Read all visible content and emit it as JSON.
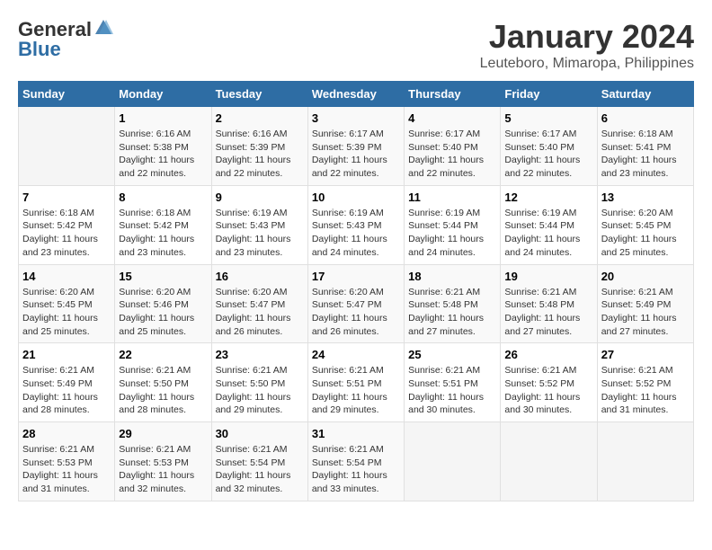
{
  "header": {
    "logo_general": "General",
    "logo_blue": "Blue",
    "month_title": "January 2024",
    "location": "Leuteboro, Mimaropa, Philippines"
  },
  "days_of_week": [
    "Sunday",
    "Monday",
    "Tuesday",
    "Wednesday",
    "Thursday",
    "Friday",
    "Saturday"
  ],
  "weeks": [
    [
      {
        "day": "",
        "info": ""
      },
      {
        "day": "1",
        "info": "Sunrise: 6:16 AM\nSunset: 5:38 PM\nDaylight: 11 hours\nand 22 minutes."
      },
      {
        "day": "2",
        "info": "Sunrise: 6:16 AM\nSunset: 5:39 PM\nDaylight: 11 hours\nand 22 minutes."
      },
      {
        "day": "3",
        "info": "Sunrise: 6:17 AM\nSunset: 5:39 PM\nDaylight: 11 hours\nand 22 minutes."
      },
      {
        "day": "4",
        "info": "Sunrise: 6:17 AM\nSunset: 5:40 PM\nDaylight: 11 hours\nand 22 minutes."
      },
      {
        "day": "5",
        "info": "Sunrise: 6:17 AM\nSunset: 5:40 PM\nDaylight: 11 hours\nand 22 minutes."
      },
      {
        "day": "6",
        "info": "Sunrise: 6:18 AM\nSunset: 5:41 PM\nDaylight: 11 hours\nand 23 minutes."
      }
    ],
    [
      {
        "day": "7",
        "info": "Sunrise: 6:18 AM\nSunset: 5:42 PM\nDaylight: 11 hours\nand 23 minutes."
      },
      {
        "day": "8",
        "info": "Sunrise: 6:18 AM\nSunset: 5:42 PM\nDaylight: 11 hours\nand 23 minutes."
      },
      {
        "day": "9",
        "info": "Sunrise: 6:19 AM\nSunset: 5:43 PM\nDaylight: 11 hours\nand 23 minutes."
      },
      {
        "day": "10",
        "info": "Sunrise: 6:19 AM\nSunset: 5:43 PM\nDaylight: 11 hours\nand 24 minutes."
      },
      {
        "day": "11",
        "info": "Sunrise: 6:19 AM\nSunset: 5:44 PM\nDaylight: 11 hours\nand 24 minutes."
      },
      {
        "day": "12",
        "info": "Sunrise: 6:19 AM\nSunset: 5:44 PM\nDaylight: 11 hours\nand 24 minutes."
      },
      {
        "day": "13",
        "info": "Sunrise: 6:20 AM\nSunset: 5:45 PM\nDaylight: 11 hours\nand 25 minutes."
      }
    ],
    [
      {
        "day": "14",
        "info": "Sunrise: 6:20 AM\nSunset: 5:45 PM\nDaylight: 11 hours\nand 25 minutes."
      },
      {
        "day": "15",
        "info": "Sunrise: 6:20 AM\nSunset: 5:46 PM\nDaylight: 11 hours\nand 25 minutes."
      },
      {
        "day": "16",
        "info": "Sunrise: 6:20 AM\nSunset: 5:47 PM\nDaylight: 11 hours\nand 26 minutes."
      },
      {
        "day": "17",
        "info": "Sunrise: 6:20 AM\nSunset: 5:47 PM\nDaylight: 11 hours\nand 26 minutes."
      },
      {
        "day": "18",
        "info": "Sunrise: 6:21 AM\nSunset: 5:48 PM\nDaylight: 11 hours\nand 27 minutes."
      },
      {
        "day": "19",
        "info": "Sunrise: 6:21 AM\nSunset: 5:48 PM\nDaylight: 11 hours\nand 27 minutes."
      },
      {
        "day": "20",
        "info": "Sunrise: 6:21 AM\nSunset: 5:49 PM\nDaylight: 11 hours\nand 27 minutes."
      }
    ],
    [
      {
        "day": "21",
        "info": "Sunrise: 6:21 AM\nSunset: 5:49 PM\nDaylight: 11 hours\nand 28 minutes."
      },
      {
        "day": "22",
        "info": "Sunrise: 6:21 AM\nSunset: 5:50 PM\nDaylight: 11 hours\nand 28 minutes."
      },
      {
        "day": "23",
        "info": "Sunrise: 6:21 AM\nSunset: 5:50 PM\nDaylight: 11 hours\nand 29 minutes."
      },
      {
        "day": "24",
        "info": "Sunrise: 6:21 AM\nSunset: 5:51 PM\nDaylight: 11 hours\nand 29 minutes."
      },
      {
        "day": "25",
        "info": "Sunrise: 6:21 AM\nSunset: 5:51 PM\nDaylight: 11 hours\nand 30 minutes."
      },
      {
        "day": "26",
        "info": "Sunrise: 6:21 AM\nSunset: 5:52 PM\nDaylight: 11 hours\nand 30 minutes."
      },
      {
        "day": "27",
        "info": "Sunrise: 6:21 AM\nSunset: 5:52 PM\nDaylight: 11 hours\nand 31 minutes."
      }
    ],
    [
      {
        "day": "28",
        "info": "Sunrise: 6:21 AM\nSunset: 5:53 PM\nDaylight: 11 hours\nand 31 minutes."
      },
      {
        "day": "29",
        "info": "Sunrise: 6:21 AM\nSunset: 5:53 PM\nDaylight: 11 hours\nand 32 minutes."
      },
      {
        "day": "30",
        "info": "Sunrise: 6:21 AM\nSunset: 5:54 PM\nDaylight: 11 hours\nand 32 minutes."
      },
      {
        "day": "31",
        "info": "Sunrise: 6:21 AM\nSunset: 5:54 PM\nDaylight: 11 hours\nand 33 minutes."
      },
      {
        "day": "",
        "info": ""
      },
      {
        "day": "",
        "info": ""
      },
      {
        "day": "",
        "info": ""
      }
    ]
  ]
}
